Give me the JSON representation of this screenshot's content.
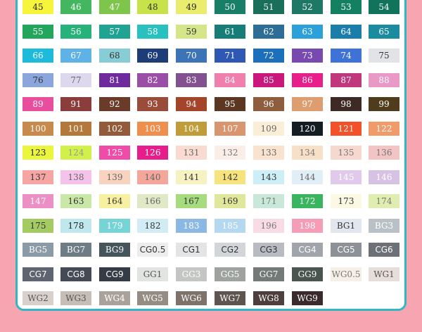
{
  "rows": [
    [
      {
        "l": "45",
        "c": "#f7f43c",
        "t": "#222222"
      },
      {
        "l": "46",
        "c": "#44b660",
        "t": "#ffffff"
      },
      {
        "l": "47",
        "c": "#7dc54b",
        "t": "#ffffff"
      },
      {
        "l": "48",
        "c": "#c8e34a",
        "t": "#333333"
      },
      {
        "l": "49",
        "c": "#e9ec6d",
        "t": "#222222"
      },
      {
        "l": "50",
        "c": "#177e67",
        "t": "#ffffff"
      },
      {
        "l": "51",
        "c": "#1a6f5b",
        "t": "#ffffff"
      },
      {
        "l": "52",
        "c": "#1e7866",
        "t": "#ffffff"
      },
      {
        "l": "53",
        "c": "#138062",
        "t": "#ffffff"
      },
      {
        "l": "54",
        "c": "#12735d",
        "t": "#ffffff"
      }
    ],
    [
      {
        "l": "55",
        "c": "#22a65b",
        "t": "#ffffff"
      },
      {
        "l": "56",
        "c": "#26b27a",
        "t": "#ffffff"
      },
      {
        "l": "57",
        "c": "#1fa494",
        "t": "#ffffff"
      },
      {
        "l": "58",
        "c": "#29c1c0",
        "t": "#ffffff"
      },
      {
        "l": "59",
        "c": "#d5e68a",
        "t": "#333333"
      },
      {
        "l": "61",
        "c": "#167e77",
        "t": "#ffffff"
      },
      {
        "l": "62",
        "c": "#2e6e96",
        "t": "#ffffff"
      },
      {
        "l": "63",
        "c": "#2ba0d9",
        "t": "#ffffff"
      },
      {
        "l": "64",
        "c": "#1b7eaa",
        "t": "#ffffff"
      },
      {
        "l": "65",
        "c": "#1b8ba0",
        "t": "#ffffff"
      }
    ],
    [
      {
        "l": "66",
        "c": "#1dbadb",
        "t": "#ffffff"
      },
      {
        "l": "67",
        "c": "#5fb2e6",
        "t": "#ffffff"
      },
      {
        "l": "68",
        "c": "#88cdd5",
        "t": "#333333"
      },
      {
        "l": "69",
        "c": "#1e3c77",
        "t": "#ffffff"
      },
      {
        "l": "70",
        "c": "#3d74b6",
        "t": "#ffffff"
      },
      {
        "l": "71",
        "c": "#2e58b3",
        "t": "#ffffff"
      },
      {
        "l": "72",
        "c": "#1c6fba",
        "t": "#ffffff"
      },
      {
        "l": "73",
        "c": "#7849b0",
        "t": "#ffffff"
      },
      {
        "l": "74",
        "c": "#3f72d6",
        "t": "#ffffff"
      },
      {
        "l": "75",
        "c": "#e2e3e7",
        "t": "#333333"
      }
    ],
    [
      {
        "l": "76",
        "c": "#8aa6dd",
        "t": "#333333"
      },
      {
        "l": "77",
        "c": "#ded8ef",
        "t": "#666666"
      },
      {
        "l": "81",
        "c": "#6f2a9d",
        "t": "#ffffff"
      },
      {
        "l": "82",
        "c": "#9a4ea7",
        "t": "#ffffff"
      },
      {
        "l": "83",
        "c": "#83518f",
        "t": "#ffffff"
      },
      {
        "l": "84",
        "c": "#f07fae",
        "t": "#ffffff"
      },
      {
        "l": "85",
        "c": "#c9177c",
        "t": "#ffffff"
      },
      {
        "l": "86",
        "c": "#e81e8a",
        "t": "#ffffff"
      },
      {
        "l": "87",
        "c": "#c0377d",
        "t": "#ffffff"
      },
      {
        "l": "88",
        "c": "#e899c6",
        "t": "#ffffff"
      }
    ],
    [
      {
        "l": "89",
        "c": "#e94e9d",
        "t": "#ffffff"
      },
      {
        "l": "91",
        "c": "#8b3d3c",
        "t": "#ffffff"
      },
      {
        "l": "92",
        "c": "#6b3b2a",
        "t": "#ffffff"
      },
      {
        "l": "93",
        "c": "#9a4c3a",
        "t": "#ffffff"
      },
      {
        "l": "94",
        "c": "#a4452a",
        "t": "#ffffff"
      },
      {
        "l": "95",
        "c": "#5b3621",
        "t": "#ffffff"
      },
      {
        "l": "96",
        "c": "#8d5d3d",
        "t": "#ffffff"
      },
      {
        "l": "97",
        "c": "#de9d6e",
        "t": "#ffffff"
      },
      {
        "l": "98",
        "c": "#3e2a25",
        "t": "#ffffff"
      },
      {
        "l": "99",
        "c": "#4f3c1c",
        "t": "#ffffff"
      }
    ],
    [
      {
        "l": "100",
        "c": "#c88a4c",
        "t": "#ffffff"
      },
      {
        "l": "101",
        "c": "#b4793a",
        "t": "#ffffff"
      },
      {
        "l": "102",
        "c": "#945b3b",
        "t": "#ffffff"
      },
      {
        "l": "103",
        "c": "#ef8f4d",
        "t": "#ffffff"
      },
      {
        "l": "104",
        "c": "#c19c3a",
        "t": "#ffffff"
      },
      {
        "l": "107",
        "c": "#d9956e",
        "t": "#ffffff"
      },
      {
        "l": "109",
        "c": "#fbeed6",
        "t": "#666666"
      },
      {
        "l": "120",
        "c": "#141d22",
        "t": "#ffffff"
      },
      {
        "l": "121",
        "c": "#f2512a",
        "t": "#ffffff"
      },
      {
        "l": "122",
        "c": "#f19a6a",
        "t": "#ffffff"
      }
    ],
    [
      {
        "l": "123",
        "c": "#eaf53c",
        "t": "#222222"
      },
      {
        "l": "124",
        "c": "#d2f04a",
        "t": "#999999"
      },
      {
        "l": "125",
        "c": "#ef4ba8",
        "t": "#ffffff"
      },
      {
        "l": "126",
        "c": "#e61d8a",
        "t": "#ffffff"
      },
      {
        "l": "131",
        "c": "#f9dbd2",
        "t": "#666666"
      },
      {
        "l": "132",
        "c": "#fbeee7",
        "t": "#777777"
      },
      {
        "l": "133",
        "c": "#f9e3cf",
        "t": "#666666"
      },
      {
        "l": "134",
        "c": "#f8e0c8",
        "t": "#777777"
      },
      {
        "l": "135",
        "c": "#f6d8cf",
        "t": "#777777"
      },
      {
        "l": "136",
        "c": "#f2c4c4",
        "t": "#777777"
      }
    ],
    [
      {
        "l": "137",
        "c": "#f5a6a3",
        "t": "#333333"
      },
      {
        "l": "138",
        "c": "#f5c3ea",
        "t": "#666666"
      },
      {
        "l": "139",
        "c": "#f8d3bf",
        "t": "#666666"
      },
      {
        "l": "140",
        "c": "#f4a69a",
        "t": "#666666"
      },
      {
        "l": "141",
        "c": "#f7f2c1",
        "t": "#333333"
      },
      {
        "l": "142",
        "c": "#f6e37e",
        "t": "#333333"
      },
      {
        "l": "143",
        "c": "#cdeef6",
        "t": "#333333"
      },
      {
        "l": "144",
        "c": "#e0eef6",
        "t": "#666666"
      },
      {
        "l": "145",
        "c": "#e0c9ea",
        "t": "#ffffff"
      },
      {
        "l": "146",
        "c": "#d6c3e4",
        "t": "#ffffff"
      }
    ],
    [
      {
        "l": "147",
        "c": "#ec8fc4",
        "t": "#ffffff"
      },
      {
        "l": "163",
        "c": "#c9e8a8",
        "t": "#333333"
      },
      {
        "l": "164",
        "c": "#f7f0a0",
        "t": "#333333"
      },
      {
        "l": "166",
        "c": "#dfe9c6",
        "t": "#666666"
      },
      {
        "l": "167",
        "c": "#a7dc7e",
        "t": "#333333"
      },
      {
        "l": "169",
        "c": "#e0e79b",
        "t": "#333333"
      },
      {
        "l": "171",
        "c": "#c9e8d9",
        "t": "#777777"
      },
      {
        "l": "172",
        "c": "#39b45f",
        "t": "#ffffff"
      },
      {
        "l": "173",
        "c": "#fbf8e4",
        "t": "#333333"
      },
      {
        "l": "174",
        "c": "#dfeeb0",
        "t": "#777777"
      }
    ],
    [
      {
        "l": "175",
        "c": "#a3cb62",
        "t": "#333333"
      },
      {
        "l": "178",
        "c": "#bfe7ee",
        "t": "#222222"
      },
      {
        "l": "179",
        "c": "#76d4d6",
        "t": "#ffffff"
      },
      {
        "l": "182",
        "c": "#d2ecf6",
        "t": "#333333"
      },
      {
        "l": "183",
        "c": "#8bb9e3",
        "t": "#ffffff"
      },
      {
        "l": "185",
        "c": "#b3d8ef",
        "t": "#ffffff"
      },
      {
        "l": "196",
        "c": "#f9dbe5",
        "t": "#777777"
      },
      {
        "l": "198",
        "c": "#f59cb7",
        "t": "#ffffff"
      },
      {
        "l": "BG1",
        "c": "#e2e6ef",
        "t": "#333333"
      },
      {
        "l": "BG3",
        "c": "#b9c1c7",
        "t": "#ffffff"
      }
    ],
    [
      {
        "l": "BG5",
        "c": "#8a9aa6",
        "t": "#ffffff"
      },
      {
        "l": "BG7",
        "c": "#6e7c86",
        "t": "#ffffff"
      },
      {
        "l": "BG9",
        "c": "#46545b",
        "t": "#ffffff"
      },
      {
        "l": "CG0.5",
        "c": "#ecedec",
        "t": "#333333",
        "sans": true
      },
      {
        "l": "CG1",
        "c": "#e3e4e6",
        "t": "#333333",
        "sans": true
      },
      {
        "l": "CG2",
        "c": "#d2d5d9",
        "t": "#333333",
        "sans": true
      },
      {
        "l": "CG3",
        "c": "#b8bcc2",
        "t": "#333333",
        "sans": true
      },
      {
        "l": "CG4",
        "c": "#a0a5ab",
        "t": "#ffffff",
        "sans": true
      },
      {
        "l": "CG5",
        "c": "#8c9197",
        "t": "#ffffff",
        "sans": true
      },
      {
        "l": "CG6",
        "c": "#6c7177",
        "t": "#ffffff",
        "sans": true
      }
    ],
    [
      {
        "l": "CG7",
        "c": "#5e6570",
        "t": "#ffffff",
        "sans": true
      },
      {
        "l": "CG8",
        "c": "#444b55",
        "t": "#ffffff",
        "sans": true
      },
      {
        "l": "CG9",
        "c": "#363c45",
        "t": "#ffffff",
        "sans": true
      },
      {
        "l": "GG1",
        "c": "#e2e4e2",
        "t": "#555555"
      },
      {
        "l": "GG3",
        "c": "#c3c6c2",
        "t": "#ffffff"
      },
      {
        "l": "GG5",
        "c": "#9fa3a0",
        "t": "#ffffff"
      },
      {
        "l": "GG7",
        "c": "#737a77",
        "t": "#ffffff"
      },
      {
        "l": "GG9",
        "c": "#4b5550",
        "t": "#ffffff"
      },
      {
        "l": "WG0.5",
        "c": "#f6efe8",
        "t": "#777777"
      },
      {
        "l": "WG1",
        "c": "#e6ded8",
        "t": "#555555"
      }
    ],
    [
      {
        "l": "WG2",
        "c": "#d8d1cb",
        "t": "#555555"
      },
      {
        "l": "WG3",
        "c": "#c5bdb6",
        "t": "#555555"
      },
      {
        "l": "WG4",
        "c": "#a9a29b",
        "t": "#ffffff"
      },
      {
        "l": "WG5",
        "c": "#958c84",
        "t": "#ffffff"
      },
      {
        "l": "WG6",
        "c": "#7d736b",
        "t": "#ffffff"
      },
      {
        "l": "WG7",
        "c": "#5f5550",
        "t": "#ffffff"
      },
      {
        "l": "WG8",
        "c": "#4e3f3e",
        "t": "#ffffff"
      },
      {
        "l": "WG9",
        "c": "#3a2a2d",
        "t": "#ffffff"
      }
    ]
  ]
}
